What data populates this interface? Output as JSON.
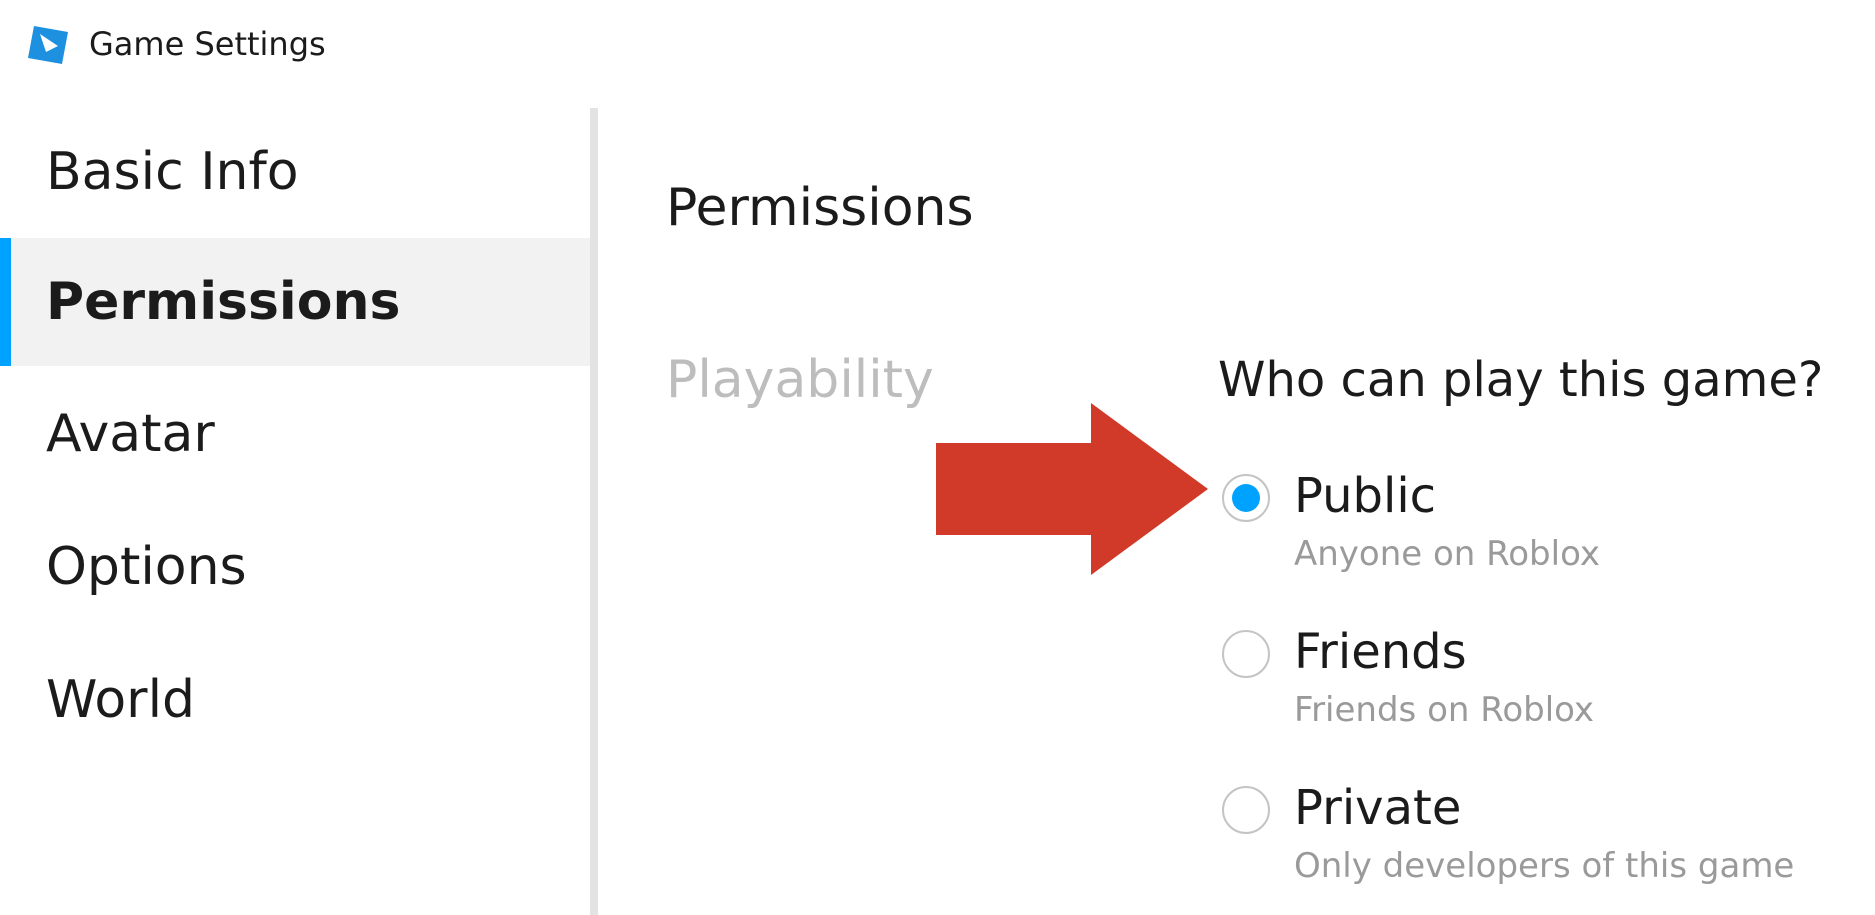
{
  "window": {
    "title": "Game Settings",
    "logo_icon": "roblox-studio-icon"
  },
  "sidebar": {
    "items": [
      {
        "label": "Basic Info",
        "active": false
      },
      {
        "label": "Permissions",
        "active": true
      },
      {
        "label": "Avatar",
        "active": false
      },
      {
        "label": "Options",
        "active": false
      },
      {
        "label": "World",
        "active": false
      }
    ]
  },
  "main": {
    "section_title": "Permissions",
    "playability": {
      "label": "Playability",
      "question": "Who can play this game?",
      "options": [
        {
          "label": "Public",
          "description": "Anyone on Roblox",
          "selected": true
        },
        {
          "label": "Friends",
          "description": "Friends on Roblox",
          "selected": false
        },
        {
          "label": "Private",
          "description": "Only developers of this game",
          "selected": false
        }
      ]
    },
    "annotation_icon": "arrow-right-icon"
  },
  "colors": {
    "accent": "#00a2ff",
    "arrow": "#d13a28",
    "active_bg": "#f2f2f2",
    "muted_text": "#bdbdbd",
    "description_text": "#9a9a9a"
  }
}
